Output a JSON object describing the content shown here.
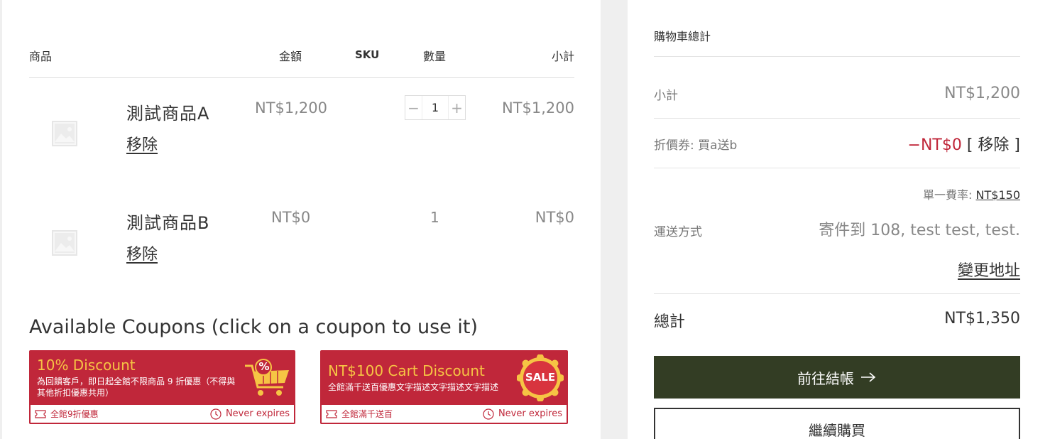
{
  "table": {
    "headers": {
      "product": "商品",
      "price": "金額",
      "sku": "SKU",
      "quantity": "數量",
      "subtotal": "小計"
    },
    "rows": [
      {
        "name": "測試商品A",
        "remove": "移除",
        "price": "NT$1,200",
        "quantity": "1",
        "subtotal": "NT$1,200",
        "qty_minus": "−",
        "qty_plus": "+"
      },
      {
        "name": "測試商品B",
        "remove": "移除",
        "price": "NT$0",
        "quantity": "1",
        "subtotal": "NT$0"
      }
    ]
  },
  "coupons": {
    "heading": "Available Coupons (click on a coupon to use it)",
    "items": [
      {
        "title": "10% Discount",
        "description": "為回饋客戶，即日起全館不限商品 9 折優惠（不得與其他折扣優惠共用）",
        "code": "全館9折優惠",
        "expiry": "Never expires",
        "badge": "%"
      },
      {
        "title": "NT$100 Cart Discount",
        "description": "全館滿千送百優惠文字描述文字描述文字描述",
        "code": "全館滿千送百",
        "expiry": "Never expires",
        "badge": "SALE"
      }
    ]
  },
  "summary": {
    "title": "購物車總計",
    "subtotal_label": "小計",
    "subtotal_value": "NT$1,200",
    "coupon_label": "折價券: 買a送b",
    "coupon_value": "−NT$0",
    "coupon_remove": "[ 移除 ]",
    "flat_rate_label": "單一費率:",
    "flat_rate_value": "NT$150",
    "shipping_label": "運送方式",
    "shipping_to": "寄件到 108, test test, test.",
    "change_address": "變更地址",
    "total_label": "總計",
    "total_value": "NT$1,350",
    "checkout_label": "前往結帳",
    "continue_label": "繼續購買"
  },
  "colors": {
    "accent_red": "#c0273a",
    "coupon_yellow": "#f6c444",
    "checkout_green": "#333d24"
  }
}
